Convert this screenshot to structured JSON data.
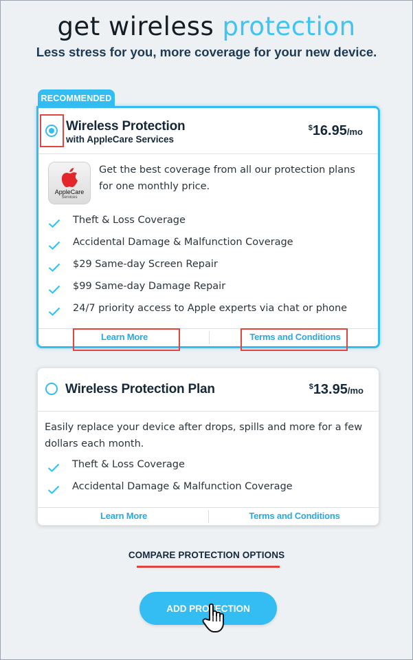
{
  "header": {
    "title_part1": "get wireless",
    "title_part2": "protection",
    "subtitle": "Less stress for you, more coverage for your new device."
  },
  "colors": {
    "accent": "#33bdf2",
    "highlight": "#e0453f",
    "text": "#15283a"
  },
  "plans": [
    {
      "badge": "RECOMMENDED",
      "selected": true,
      "name": "Wireless Protection",
      "subname": "with AppleCare Services",
      "price_currency": "$",
      "price": "16.95",
      "price_period": "/mo",
      "logo_line1": "AppleCare",
      "logo_line2": "Services",
      "description": "Get the best coverage from all our protection plans for one monthly price.",
      "features": [
        "Theft & Loss Coverage",
        "Accidental Damage & Malfunction Coverage",
        "$29 Same-day Screen Repair",
        "$99 Same-day Damage Repair",
        "24/7 priority access to Apple experts via chat or phone"
      ],
      "learn_more": "Learn More",
      "terms": "Terms and Conditions"
    },
    {
      "selected": false,
      "name": "Wireless Protection Plan",
      "price_currency": "$",
      "price": "13.95",
      "price_period": "/mo",
      "description": "Easily replace your device after drops, spills and more for a few dollars each month.",
      "features": [
        "Theft & Loss Coverage",
        "Accidental Damage & Malfunction Coverage"
      ],
      "learn_more": "Learn More",
      "terms": "Terms and Conditions"
    }
  ],
  "compare_link": "COMPARE PROTECTION OPTIONS",
  "add_button": "ADD PROTECTION",
  "icons": {
    "check": "check-icon",
    "apple": "apple-logo-icon",
    "cursor": "hand-cursor-icon"
  }
}
